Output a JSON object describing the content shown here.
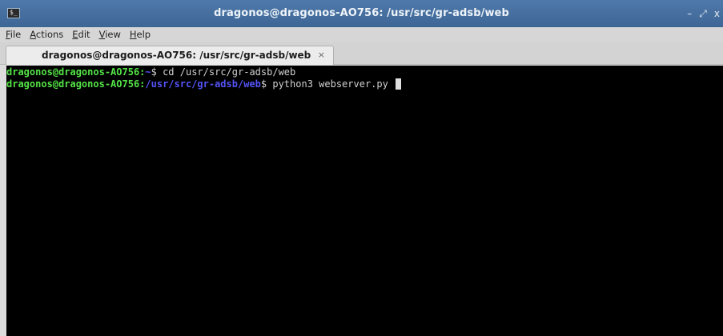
{
  "window": {
    "title": "dragonos@dragonos-AO756: /usr/src/gr-adsb/web",
    "controls": {
      "minimize": "–",
      "maximize": "⤢",
      "close": "x"
    }
  },
  "menubar": {
    "items": [
      {
        "accel": "F",
        "rest": "ile"
      },
      {
        "accel": "A",
        "rest": "ctions"
      },
      {
        "accel": "E",
        "rest": "dit"
      },
      {
        "accel": "V",
        "rest": "iew"
      },
      {
        "accel": "H",
        "rest": "elp"
      }
    ]
  },
  "tabs": [
    {
      "label": "dragonos@dragonos-AO756: /usr/src/gr-adsb/web",
      "close": "×"
    }
  ],
  "terminal": {
    "lines": [
      {
        "user": "dragonos@dragonos-AO756:",
        "path": "~",
        "prompt": "$",
        "command": " cd /usr/src/gr-adsb/web"
      },
      {
        "user": "dragonos@dragonos-AO756:",
        "path": "/usr/src/gr-adsb/web",
        "prompt": "$",
        "command": " python3 webserver.py "
      }
    ]
  },
  "colors": {
    "titlebar": "#3d6696",
    "terminal_bg": "#000000",
    "prompt_user": "#54e346",
    "prompt_path": "#5353f5",
    "text": "#d0d0d0"
  }
}
